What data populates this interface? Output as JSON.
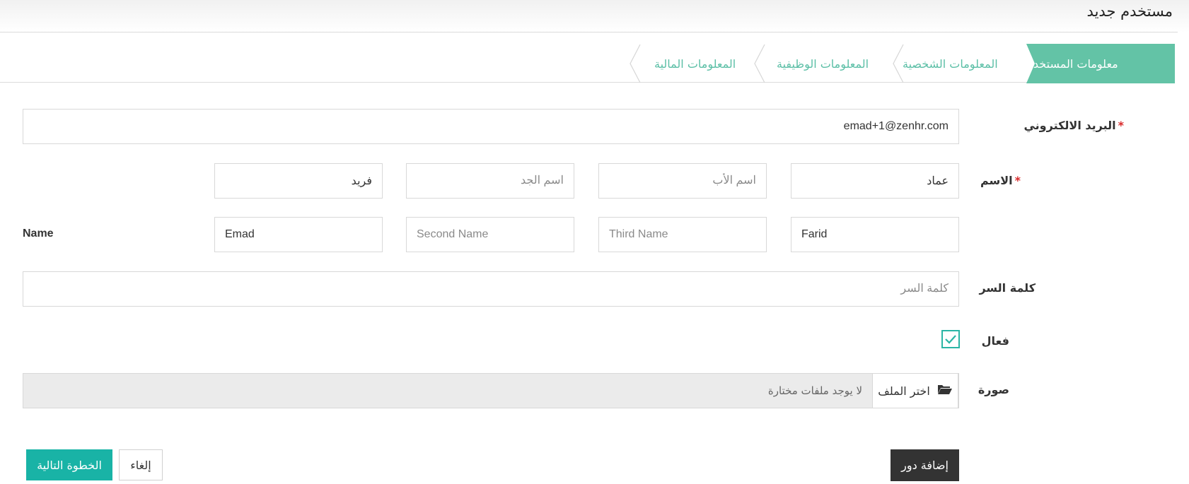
{
  "page": {
    "title": "مستخدم جديد"
  },
  "wizard": {
    "steps": [
      {
        "label": "معلومات المستخدم",
        "active": true
      },
      {
        "label": "المعلومات الشخصية",
        "active": false
      },
      {
        "label": "المعلومات الوظيفية",
        "active": false
      },
      {
        "label": "المعلومات المالية",
        "active": false
      }
    ]
  },
  "form": {
    "email": {
      "label": "البريد الالكتروني",
      "required_mark": "*",
      "value": "emad+1@zenhr.com"
    },
    "name": {
      "label": "الاسم",
      "required_mark": "*",
      "arabic": {
        "first": {
          "value": "عماد",
          "placeholder": ""
        },
        "father": {
          "value": "",
          "placeholder": "اسم الأب"
        },
        "grandfather": {
          "value": "",
          "placeholder": "اسم الجد"
        },
        "family": {
          "value": "فريد",
          "placeholder": ""
        }
      },
      "english_label": "Name",
      "english": {
        "first": {
          "value": "Farid",
          "placeholder": ""
        },
        "second": {
          "value": "",
          "placeholder": "Third Name"
        },
        "third": {
          "value": "",
          "placeholder": "Second Name"
        },
        "last": {
          "value": "Emad",
          "placeholder": ""
        }
      }
    },
    "password": {
      "label": "كلمة السر",
      "placeholder": "كلمة السر",
      "value": ""
    },
    "active": {
      "label": "فعال",
      "checked": true
    },
    "photo": {
      "label": "صورة",
      "button_label": "اختر الملف",
      "status": "لا يوجد ملفات مختارة"
    }
  },
  "actions": {
    "add_role": "إضافة دور",
    "cancel": "إلغاء",
    "next": "الخطوة التالية"
  },
  "colors": {
    "accent": "#63c3a6",
    "primary_button": "#19b3a6",
    "dark_button": "#333333",
    "required": "#d9292a"
  }
}
